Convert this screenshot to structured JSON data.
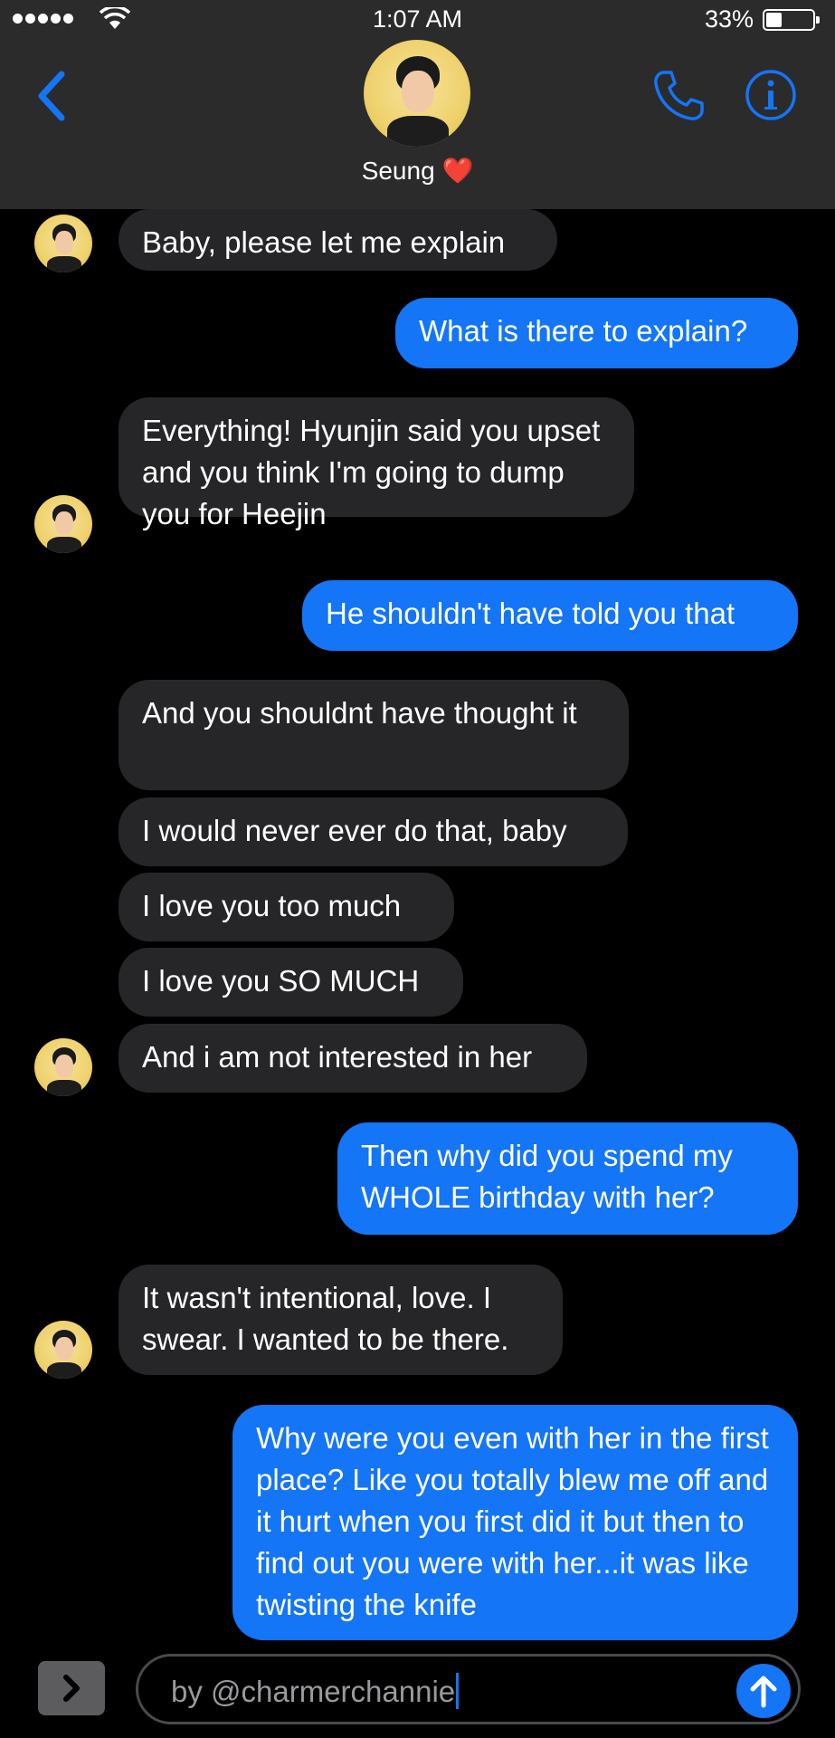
{
  "status_bar": {
    "time": "1:07 AM",
    "battery_pct": "33%"
  },
  "header": {
    "contact_name": "Seung",
    "heart": "❤️"
  },
  "messages": [
    {
      "from": "them",
      "text": "Baby, please let me explain"
    },
    {
      "from": "me",
      "text": "What is there to explain?"
    },
    {
      "from": "them",
      "text": "Everything! Hyunjin said you upset and you think I'm going to dump you for Heejin"
    },
    {
      "from": "me",
      "text": "He shouldn't have told you that"
    },
    {
      "from": "them",
      "text": "And you shouldnt have thought it"
    },
    {
      "from": "them",
      "text": "I would never ever do that, baby"
    },
    {
      "from": "them",
      "text": "I love you too much"
    },
    {
      "from": "them",
      "text": "I love you SO MUCH"
    },
    {
      "from": "them",
      "text": "And i am not interested in her"
    },
    {
      "from": "me",
      "text": "Then why did you spend my WHOLE birthday with her?"
    },
    {
      "from": "them",
      "text": "It wasn't intentional, love. I swear. I wanted to be there."
    },
    {
      "from": "me",
      "text": "Why were you even with her in the first place? Like you totally blew me off and it hurt when you first did it but then to find out you were with her...it was like twisting the knife"
    }
  ],
  "composer": {
    "text": "by @charmerchannie"
  },
  "colors": {
    "accent": "#1475f6",
    "incoming_bubble": "#262628",
    "header_bg": "#2b2b2b"
  }
}
